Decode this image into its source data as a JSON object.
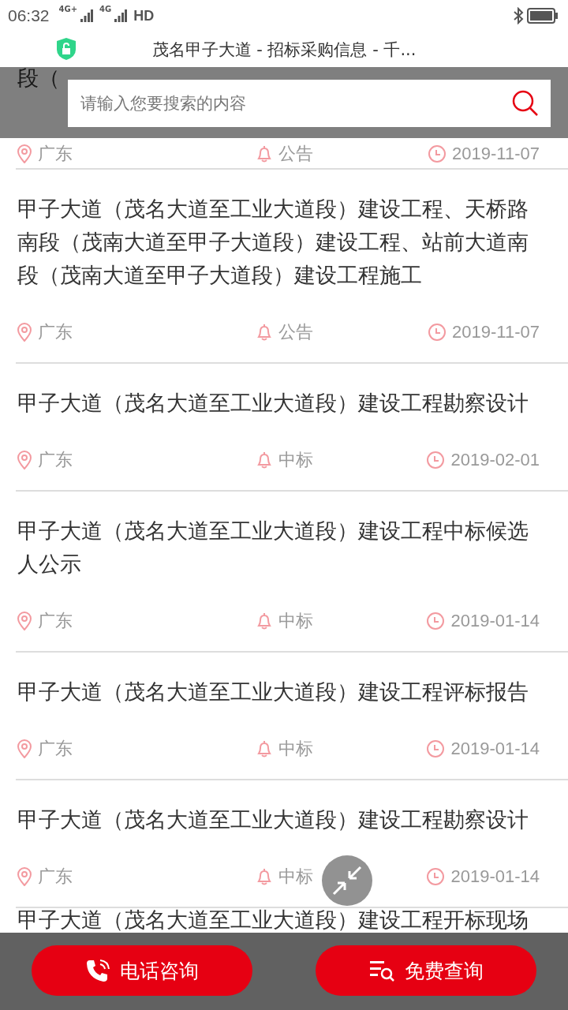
{
  "status_bar": {
    "time": "06:32",
    "networks": [
      "4G+",
      "4G"
    ],
    "hd": "HD"
  },
  "header": {
    "title": "茂名甲子大道 - 招标采购信息 - 千..."
  },
  "search": {
    "placeholder": "请输入您要搜索的内容"
  },
  "items": [
    {
      "title": "段（",
      "region": "广东",
      "category": "公告",
      "date": "2019-11-07"
    },
    {
      "title": "甲子大道（茂名大道至工业大道段）建设工程、天桥路南段（茂南大道至甲子大道段）建设工程、站前大道南段（茂南大道至甲子大道段）建设工程施工",
      "region": "广东",
      "category": "公告",
      "date": "2019-11-07"
    },
    {
      "title": "甲子大道（茂名大道至工业大道段）建设工程勘察设计",
      "region": "广东",
      "category": "中标",
      "date": "2019-02-01"
    },
    {
      "title": "甲子大道（茂名大道至工业大道段）建设工程中标候选人公示",
      "region": "广东",
      "category": "中标",
      "date": "2019-01-14"
    },
    {
      "title": "甲子大道（茂名大道至工业大道段）建设工程评标报告",
      "region": "广东",
      "category": "中标",
      "date": "2019-01-14"
    },
    {
      "title": "甲子大道（茂名大道至工业大道段）建设工程勘察设计",
      "region": "广东",
      "category": "中标",
      "date": "2019-01-14"
    },
    {
      "title": "甲子大道（茂名大道至工业大道段）建设工程开标现场"
    }
  ],
  "actions": [
    {
      "kind": "phone",
      "label": "电话咨询"
    },
    {
      "kind": "query",
      "label": "免费查询"
    }
  ]
}
